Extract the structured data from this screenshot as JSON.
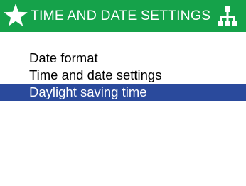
{
  "header": {
    "title": "TIME AND DATE SETTINGS",
    "left_icon": "star-icon",
    "right_icon": "network-icon",
    "background_color": "#15a24a"
  },
  "menu": {
    "items": [
      {
        "label": "Date format",
        "selected": false
      },
      {
        "label": "Time and date settings",
        "selected": false
      },
      {
        "label": "Daylight saving time",
        "selected": true
      }
    ],
    "selected_color": "#2a4a9c"
  }
}
